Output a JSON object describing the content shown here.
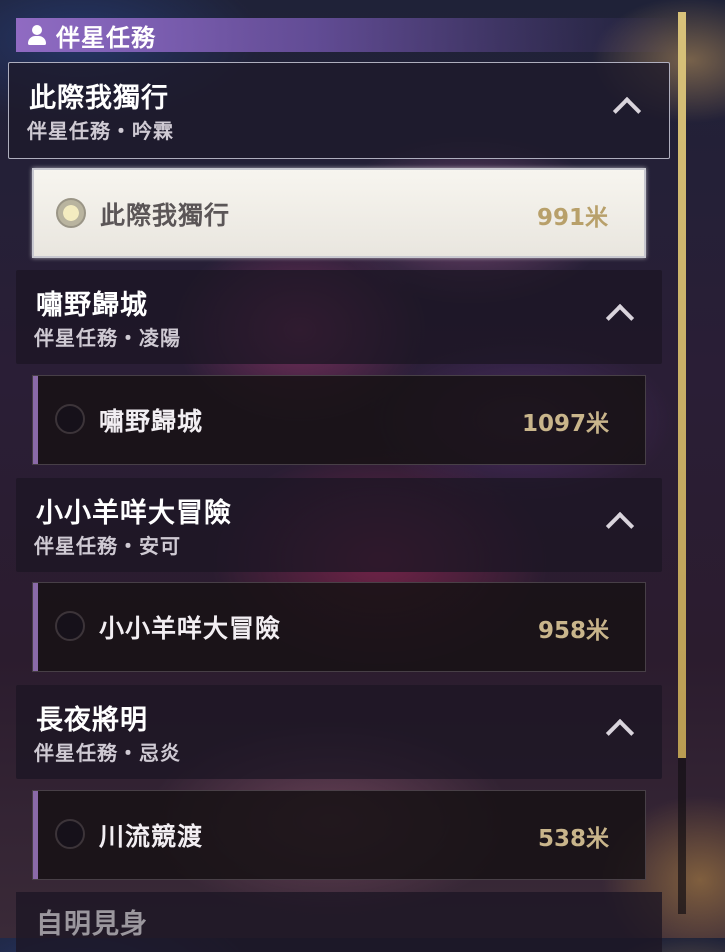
{
  "panel": {
    "title": "伴星任務",
    "icon": "person-icon"
  },
  "groups": [
    {
      "title": "此際我獨行",
      "subtitle": "伴星任務・吟霖",
      "quest": {
        "name": "此際我獨行",
        "distance": "991米"
      }
    },
    {
      "title": "嘯野歸城",
      "subtitle": "伴星任務・凌陽",
      "quest": {
        "name": "嘯野歸城",
        "distance": "1097米"
      }
    },
    {
      "title": "小小羊咩大冒險",
      "subtitle": "伴星任務・安可",
      "quest": {
        "name": "小小羊咩大冒險",
        "distance": "958米"
      }
    },
    {
      "title": "長夜將明",
      "subtitle": "伴星任務・忌炎",
      "quest": {
        "name": "川流競渡",
        "distance": "538米"
      }
    }
  ],
  "partial_group": {
    "title": "自明見身"
  },
  "colors": {
    "accent_purple": "#8a6aa8",
    "distance_gold": "#c9b58b",
    "scroll_thumb": "#d8c27a"
  }
}
